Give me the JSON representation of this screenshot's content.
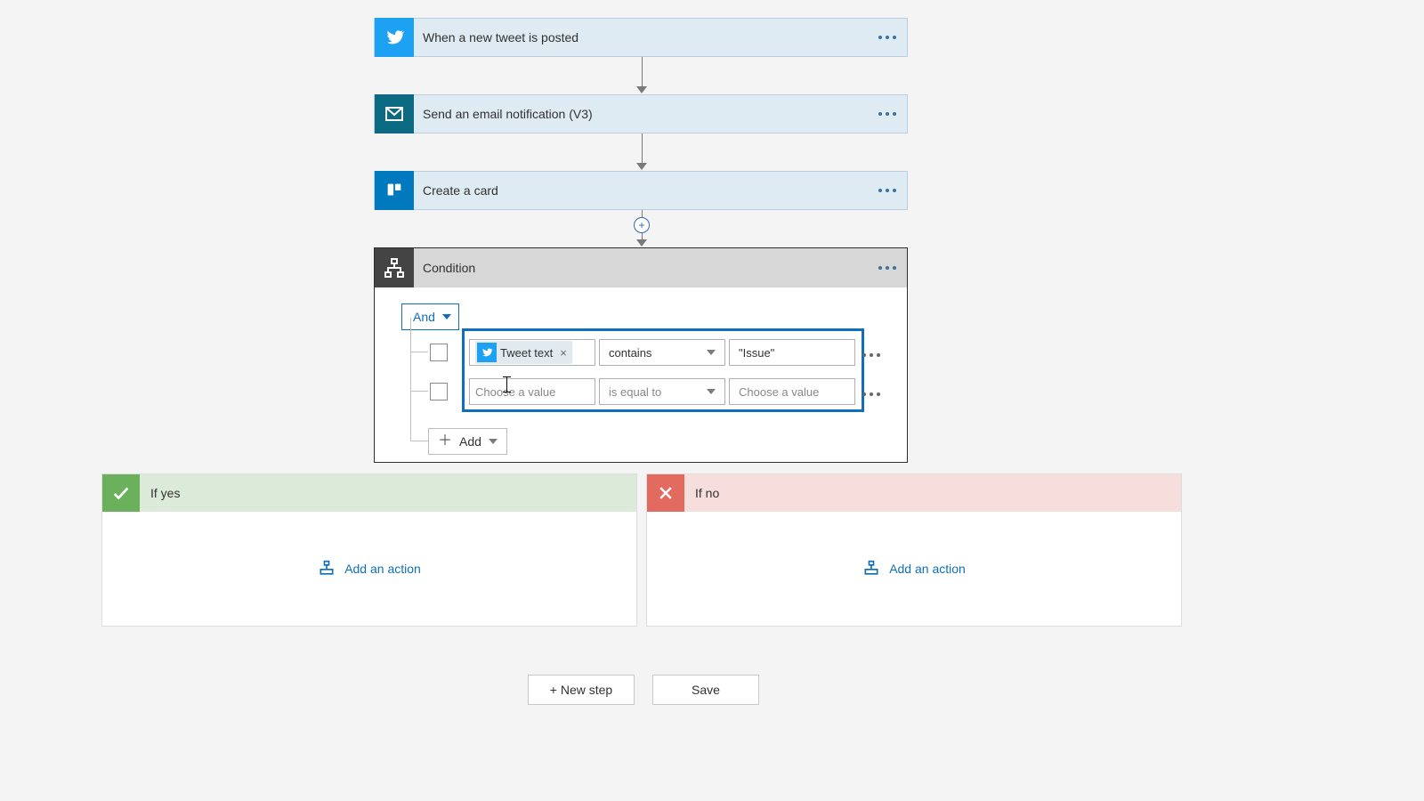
{
  "steps": [
    {
      "title": "When a new tweet is posted",
      "icon": "twitter",
      "icon_bg": "#1da1f2"
    },
    {
      "title": "Send an email notification (V3)",
      "icon": "mail",
      "icon_bg": "#0b6a82"
    },
    {
      "title": "Create a card",
      "icon": "trello",
      "icon_bg": "#0079bf"
    }
  ],
  "condition": {
    "title": "Condition",
    "operator": "And",
    "rows": [
      {
        "token": "Tweet text",
        "op": "contains",
        "rhs": "\"Issue\""
      },
      {
        "lhs_placeholder": "Choose a value",
        "op_placeholder": "is equal to",
        "rhs_placeholder": "Choose a value"
      }
    ],
    "add_label": "Add"
  },
  "branches": {
    "yes_label": "If yes",
    "no_label": "If no",
    "add_action_label": "Add an action"
  },
  "footer": {
    "new_step": "+ New step",
    "save": "Save"
  }
}
